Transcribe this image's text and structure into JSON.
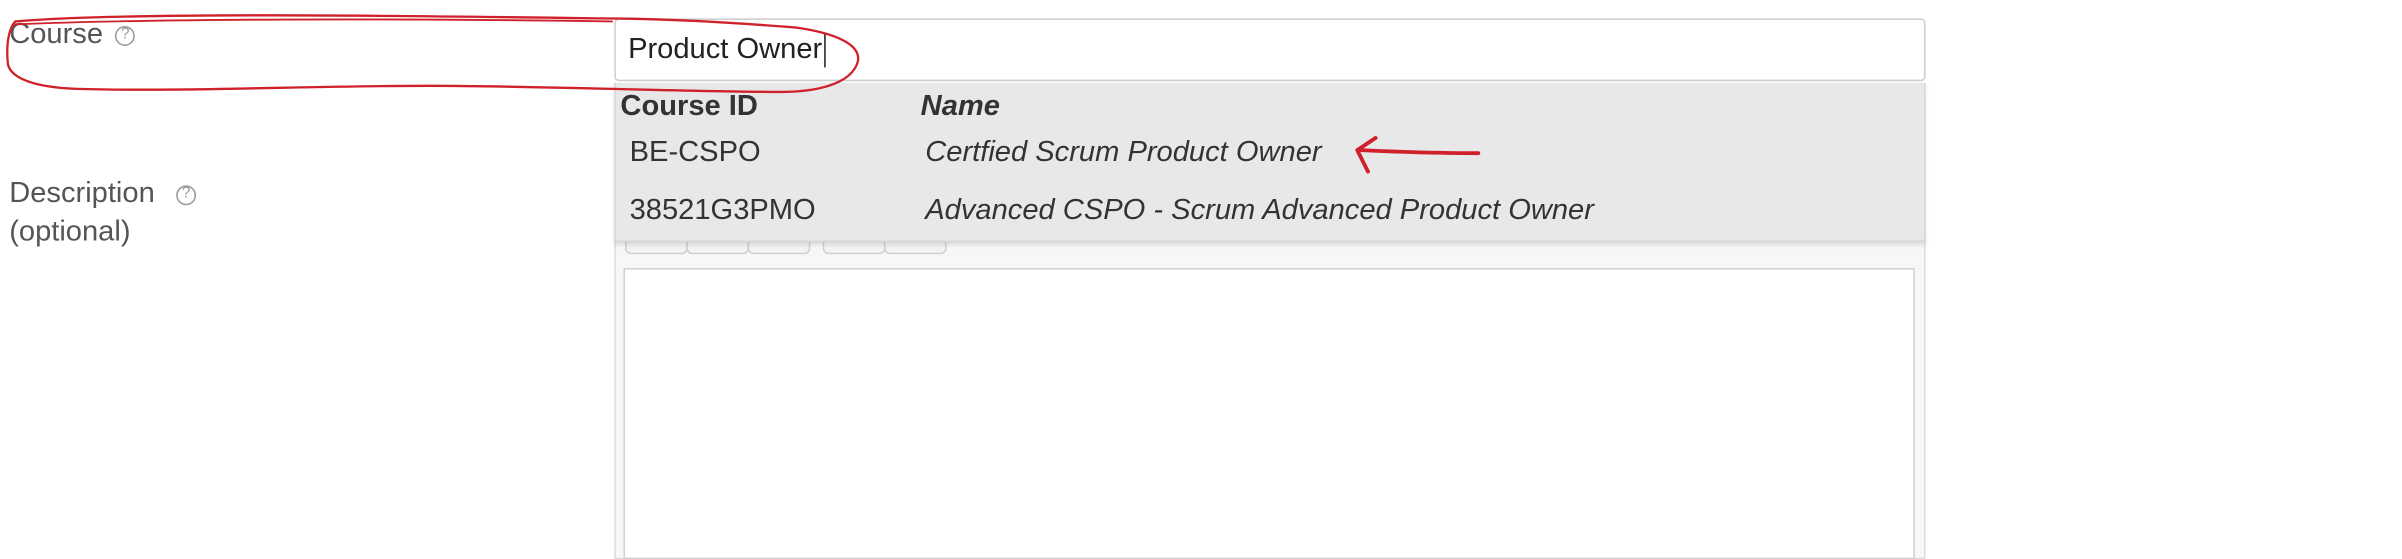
{
  "form": {
    "course_label": "Course",
    "course_help_icon": "question-circle-icon",
    "course_value": "Product Owner",
    "description_label": "Description",
    "description_help_icon": "question-circle-icon",
    "description_optional": "(optional)"
  },
  "dropdown": {
    "columns": [
      "Course ID",
      "Name"
    ],
    "rows": [
      {
        "id": "BE-CSPO",
        "name": "Certfied Scrum Product Owner"
      },
      {
        "id": "38521G3PMO",
        "name": "Advanced CSPO - Scrum Advanced Product Owner"
      }
    ]
  },
  "annotations": {
    "color": "#d0202a",
    "arrow_icon": "left-arrow-icon"
  },
  "colors": {
    "label": "#555555",
    "dropdown_bg": "#e8e8e8",
    "input_border": "#cccccc"
  }
}
